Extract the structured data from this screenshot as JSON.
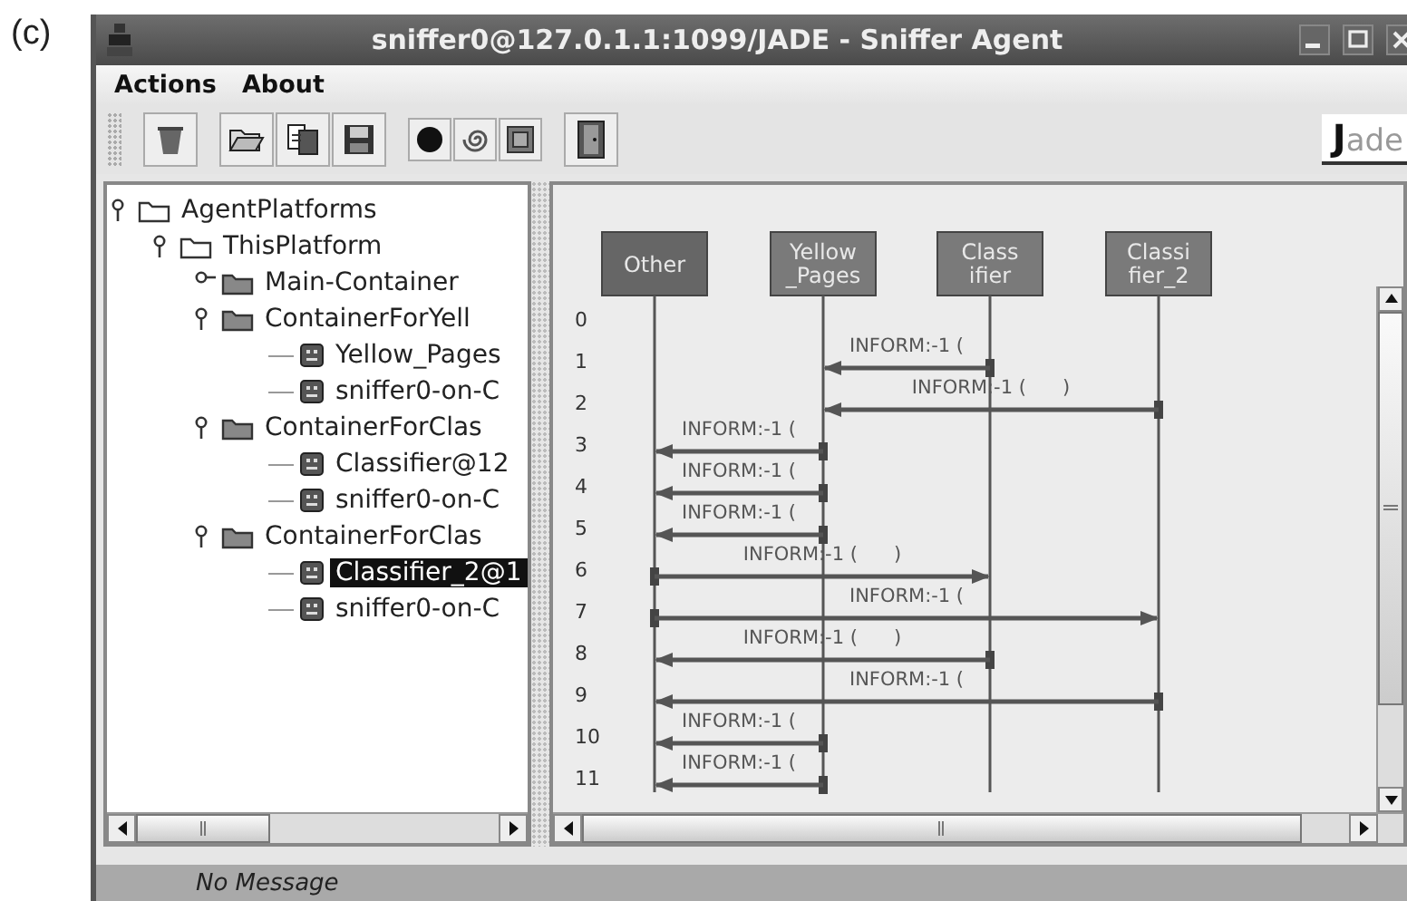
{
  "figure_label": "(c)",
  "window": {
    "title": "sniffer0@127.0.1.1:1099/JADE - Sniffer Agent"
  },
  "menu": [
    {
      "label": "Actions"
    },
    {
      "label": "About"
    }
  ],
  "logo": {
    "text": "Jade"
  },
  "tree": [
    {
      "label": "AgentPlatforms",
      "kind": "platform",
      "expanded": true,
      "selected": false,
      "children": [
        {
          "label": "ThisPlatform",
          "kind": "platform",
          "expanded": true,
          "selected": false,
          "children": [
            {
              "label": "Main-Container",
              "kind": "container",
              "expanded": false,
              "selected": false
            },
            {
              "label": "ContainerForYell",
              "kind": "container",
              "expanded": true,
              "selected": false,
              "children": [
                {
                  "label": "Yellow_Pages",
                  "kind": "agent",
                  "selected": false
                },
                {
                  "label": "sniffer0-on-C",
                  "kind": "agent",
                  "selected": false
                }
              ]
            },
            {
              "label": "ContainerForClas",
              "kind": "container",
              "expanded": true,
              "selected": false,
              "children": [
                {
                  "label": "Classifier@12",
                  "kind": "agent",
                  "selected": false
                },
                {
                  "label": "sniffer0-on-C",
                  "kind": "agent",
                  "selected": false
                }
              ]
            },
            {
              "label": "ContainerForClas",
              "kind": "container",
              "expanded": true,
              "selected": false,
              "children": [
                {
                  "label": "Classifier_2@1",
                  "kind": "agent",
                  "selected": true
                },
                {
                  "label": "sniffer0-on-C",
                  "kind": "agent",
                  "selected": false
                }
              ]
            }
          ]
        }
      ]
    }
  ],
  "agents": [
    {
      "name": "Other",
      "kind": "other"
    },
    {
      "name": "Yellow\n_Pages",
      "kind": "agent"
    },
    {
      "name": "Class\nifier",
      "kind": "agent"
    },
    {
      "name": "Classi\nfier_2",
      "kind": "agent"
    }
  ],
  "rows": [
    {
      "number": "0"
    },
    {
      "number": "1",
      "message": {
        "label": "INFORM:-1 ("
      }
    },
    {
      "number": "2",
      "message": {
        "label": "INFORM:-1 (      )"
      }
    },
    {
      "number": "3",
      "message": {
        "label": "INFORM:-1 ("
      }
    },
    {
      "number": "4",
      "message": {
        "label": "INFORM:-1 ("
      }
    },
    {
      "number": "5",
      "message": {
        "label": "INFORM:-1 ("
      }
    },
    {
      "number": "6",
      "message": {
        "label": "INFORM:-1 (      )"
      }
    },
    {
      "number": "7",
      "message": {
        "label": "INFORM:-1 ("
      }
    },
    {
      "number": "8",
      "message": {
        "label": "INFORM:-1 (      )"
      }
    },
    {
      "number": "9",
      "message": {
        "label": "INFORM:-1 ("
      }
    },
    {
      "number": "10",
      "message": {
        "label": "INFORM:-1 ("
      }
    },
    {
      "number": "11",
      "message": {
        "label": "INFORM:-1 ("
      }
    }
  ],
  "status_bar": {
    "text": "No Message"
  }
}
